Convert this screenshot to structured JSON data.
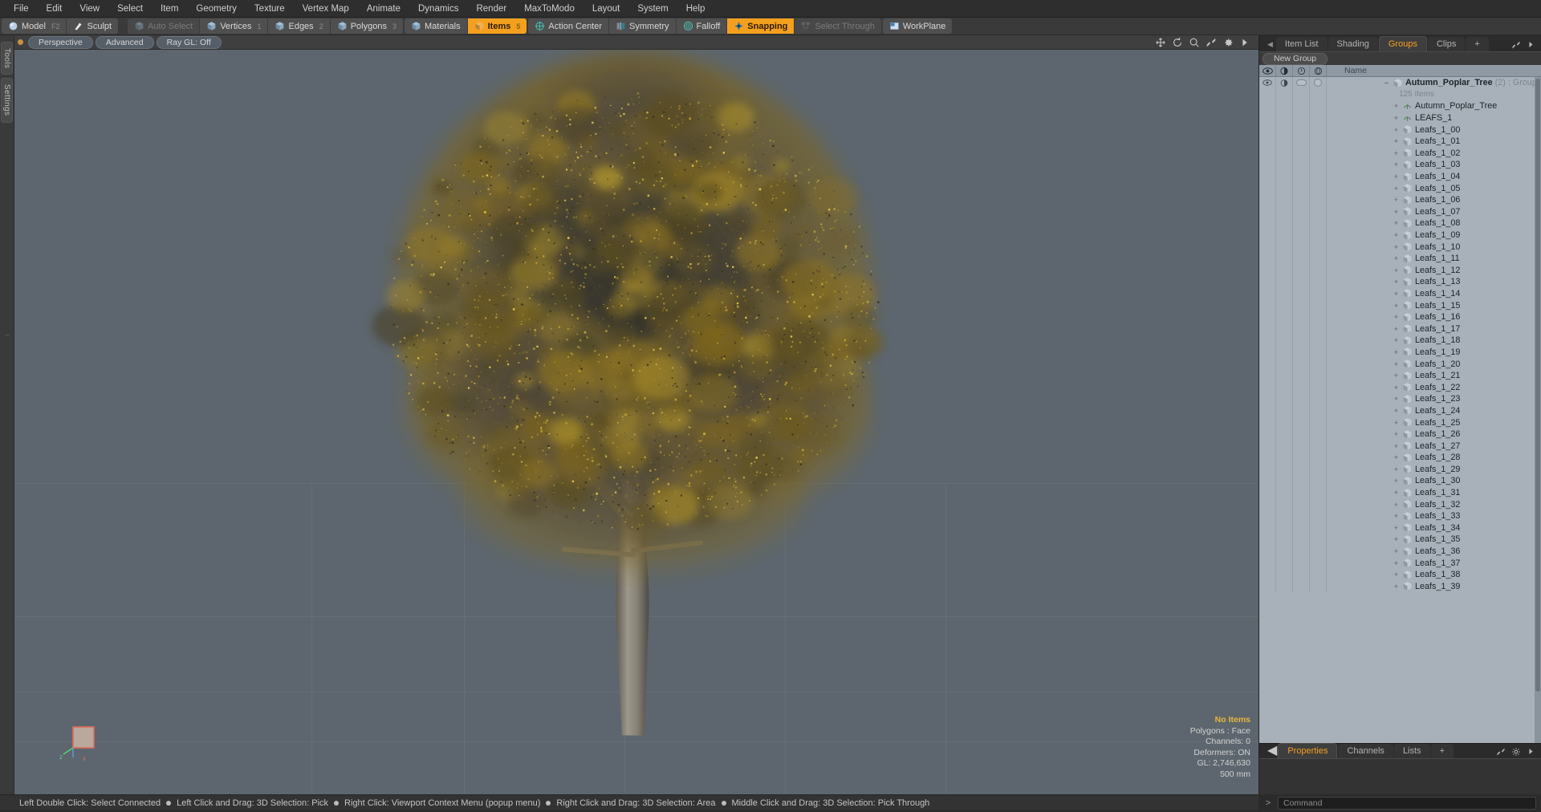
{
  "menubar": {
    "items": [
      "File",
      "Edit",
      "View",
      "Select",
      "Item",
      "Geometry",
      "Texture",
      "Vertex Map",
      "Animate",
      "Dynamics",
      "Render",
      "MaxToModo",
      "Layout",
      "System",
      "Help"
    ]
  },
  "toolbar": {
    "mode_group": [
      {
        "label": "Model",
        "icon": "sphere-icon",
        "key": "F2",
        "state": "normal"
      },
      {
        "label": "Sculpt",
        "icon": "brush-icon",
        "key": "",
        "state": "normal"
      }
    ],
    "select_group": [
      {
        "label": "Auto Select",
        "icon": "cube-icon",
        "key": "",
        "state": "dim"
      },
      {
        "label": "Vertices",
        "icon": "cube-icon",
        "key": "1",
        "state": "normal"
      },
      {
        "label": "Edges",
        "icon": "cube-icon",
        "key": "2",
        "state": "normal"
      },
      {
        "label": "Polygons",
        "icon": "cube-icon",
        "key": "3",
        "state": "normal"
      }
    ],
    "items_group": [
      {
        "label": "Materials",
        "icon": "cube-icon",
        "key": "",
        "state": "normal"
      },
      {
        "label": "Items",
        "icon": "cube-icon",
        "key": "5",
        "state": "active"
      }
    ],
    "center_group": [
      {
        "label": "Action Center",
        "icon": "target-icon",
        "key": "",
        "state": "normal"
      },
      {
        "label": "Symmetry",
        "icon": "symmetry-icon",
        "key": "",
        "state": "normal"
      },
      {
        "label": "Falloff",
        "icon": "falloff-icon",
        "key": "",
        "state": "normal"
      },
      {
        "label": "Snapping",
        "icon": "snap-icon",
        "key": "",
        "state": "active"
      },
      {
        "label": "Select Through",
        "icon": "selectthrough-icon",
        "key": "",
        "state": "dim"
      }
    ],
    "workplane_group": [
      {
        "label": "WorkPlane",
        "icon": "workplane-icon",
        "key": "",
        "state": "normal"
      }
    ]
  },
  "leftrail": {
    "tabs": [
      "Tools",
      "Settings"
    ]
  },
  "viewport": {
    "header": {
      "view_mode": "Perspective",
      "shading": "Advanced",
      "raygl": "Ray GL: Off",
      "icons": [
        "move-icon",
        "rotate-icon",
        "zoom-icon",
        "fit-icon",
        "gear-icon",
        "chevron-right-icon"
      ]
    },
    "info": {
      "selection": "No Items",
      "polygons": "Polygons : Face",
      "channels": "Channels: 0",
      "deformers": "Deformers: ON",
      "gl": "GL: 2,746,630",
      "scale": "500 mm"
    },
    "axis_labels": [
      "z",
      "x"
    ],
    "model_name": "Autumn Poplar Tree"
  },
  "rightpanel": {
    "tabs": [
      {
        "label": "Item List",
        "active": false
      },
      {
        "label": "Shading",
        "active": false
      },
      {
        "label": "Groups",
        "active": true
      },
      {
        "label": "Clips",
        "active": false
      },
      {
        "label": "+",
        "active": false
      }
    ],
    "new_group_label": "New Group",
    "columns": [
      "visible-icon",
      "render-icon",
      "lock-icon",
      "wireframe-icon"
    ],
    "name_column": "Name",
    "group": {
      "name": "Autumn_Poplar_Tree",
      "count": "(2)",
      "type": ": Group",
      "subtitle": "125 Items"
    },
    "items": [
      {
        "label": "Autumn_Poplar_Tree",
        "icon": "locator-icon"
      },
      {
        "label": "LEAFS_1",
        "icon": "locator-icon"
      },
      {
        "label": "Leafs_1_00",
        "icon": "mesh-icon"
      },
      {
        "label": "Leafs_1_01",
        "icon": "mesh-icon"
      },
      {
        "label": "Leafs_1_02",
        "icon": "mesh-icon"
      },
      {
        "label": "Leafs_1_03",
        "icon": "mesh-icon"
      },
      {
        "label": "Leafs_1_04",
        "icon": "mesh-icon"
      },
      {
        "label": "Leafs_1_05",
        "icon": "mesh-icon"
      },
      {
        "label": "Leafs_1_06",
        "icon": "mesh-icon"
      },
      {
        "label": "Leafs_1_07",
        "icon": "mesh-icon"
      },
      {
        "label": "Leafs_1_08",
        "icon": "mesh-icon"
      },
      {
        "label": "Leafs_1_09",
        "icon": "mesh-icon"
      },
      {
        "label": "Leafs_1_10",
        "icon": "mesh-icon"
      },
      {
        "label": "Leafs_1_11",
        "icon": "mesh-icon"
      },
      {
        "label": "Leafs_1_12",
        "icon": "mesh-icon"
      },
      {
        "label": "Leafs_1_13",
        "icon": "mesh-icon"
      },
      {
        "label": "Leafs_1_14",
        "icon": "mesh-icon"
      },
      {
        "label": "Leafs_1_15",
        "icon": "mesh-icon"
      },
      {
        "label": "Leafs_1_16",
        "icon": "mesh-icon"
      },
      {
        "label": "Leafs_1_17",
        "icon": "mesh-icon"
      },
      {
        "label": "Leafs_1_18",
        "icon": "mesh-icon"
      },
      {
        "label": "Leafs_1_19",
        "icon": "mesh-icon"
      },
      {
        "label": "Leafs_1_20",
        "icon": "mesh-icon"
      },
      {
        "label": "Leafs_1_21",
        "icon": "mesh-icon"
      },
      {
        "label": "Leafs_1_22",
        "icon": "mesh-icon"
      },
      {
        "label": "Leafs_1_23",
        "icon": "mesh-icon"
      },
      {
        "label": "Leafs_1_24",
        "icon": "mesh-icon"
      },
      {
        "label": "Leafs_1_25",
        "icon": "mesh-icon"
      },
      {
        "label": "Leafs_1_26",
        "icon": "mesh-icon"
      },
      {
        "label": "Leafs_1_27",
        "icon": "mesh-icon"
      },
      {
        "label": "Leafs_1_28",
        "icon": "mesh-icon"
      },
      {
        "label": "Leafs_1_29",
        "icon": "mesh-icon"
      },
      {
        "label": "Leafs_1_30",
        "icon": "mesh-icon"
      },
      {
        "label": "Leafs_1_31",
        "icon": "mesh-icon"
      },
      {
        "label": "Leafs_1_32",
        "icon": "mesh-icon"
      },
      {
        "label": "Leafs_1_33",
        "icon": "mesh-icon"
      },
      {
        "label": "Leafs_1_34",
        "icon": "mesh-icon"
      },
      {
        "label": "Leafs_1_35",
        "icon": "mesh-icon"
      },
      {
        "label": "Leafs_1_36",
        "icon": "mesh-icon"
      },
      {
        "label": "Leafs_1_37",
        "icon": "mesh-icon"
      },
      {
        "label": "Leafs_1_38",
        "icon": "mesh-icon"
      },
      {
        "label": "Leafs_1_39",
        "icon": "mesh-icon"
      }
    ],
    "bottom_tabs": [
      {
        "label": "Properties",
        "active": true
      },
      {
        "label": "Channels",
        "active": false
      },
      {
        "label": "Lists",
        "active": false
      },
      {
        "label": "+",
        "active": false
      }
    ]
  },
  "command": {
    "prompt": ">",
    "placeholder": "Command",
    "value": ""
  },
  "statusbar": {
    "hints": [
      "Left Double Click: Select Connected",
      "Left Click and Drag: 3D Selection: Pick",
      "Right Click: Viewport Context Menu (popup menu)",
      "Right Click and Drag: 3D Selection: Area",
      "Middle Click and Drag: 3D Selection: Pick Through"
    ]
  },
  "colors": {
    "accent": "#f4a01e",
    "viewport_bg": "#5d666e",
    "list_bg": "#a8b1b9",
    "chrome": "#3a3a3a"
  }
}
